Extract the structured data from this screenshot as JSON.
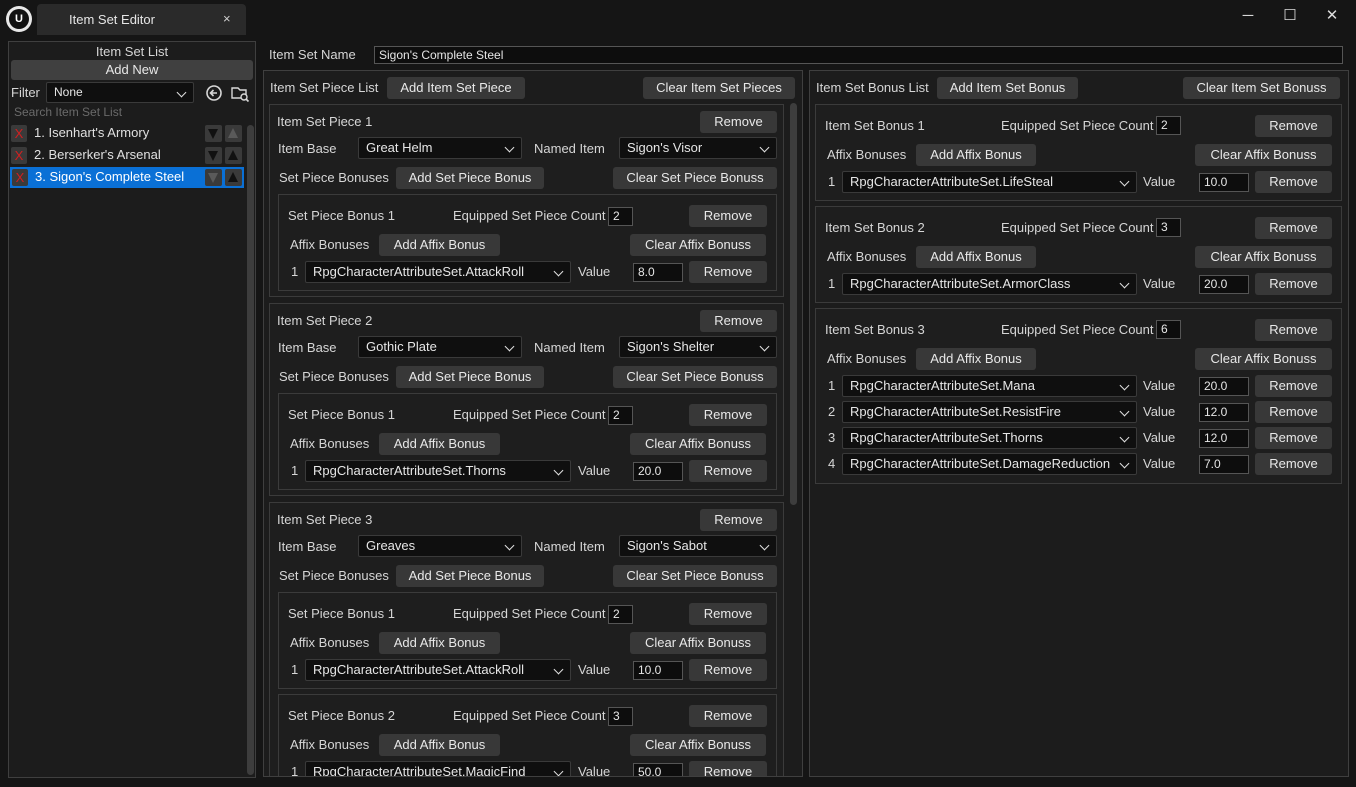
{
  "window": {
    "tab_title": "Item Set Editor",
    "tab_close": "×",
    "minimize": "─",
    "maximize": "☐",
    "close": "✕",
    "logo": "U"
  },
  "sidebar": {
    "title": "Item Set List",
    "add_new": "Add New",
    "filter_label": "Filter",
    "filter_value": "None",
    "search_placeholder": "Search Item Set List",
    "remove_glyph": "X",
    "items": [
      {
        "label": "1.  Isenhart's Armory",
        "selected": false
      },
      {
        "label": "2.  Berserker's Arsenal",
        "selected": false
      },
      {
        "label": "3.  Sigon's Complete Steel",
        "selected": true
      }
    ]
  },
  "header": {
    "name_label": "Item Set Name",
    "name_value": "Sigon's Complete Steel"
  },
  "pieces": {
    "title": "Item Set Piece List",
    "add_label": "Add Item Set Piece",
    "clear_label": "Clear Item Set Pieces",
    "item_base_label": "Item Base",
    "named_item_label": "Named Item",
    "set_piece_bonuses_label": "Set Piece Bonuses",
    "add_set_piece_bonus": "Add Set Piece Bonus",
    "clear_set_piece_bonuss": "Clear Set Piece Bonuss",
    "equipped_count_label": "Equipped Set Piece Count",
    "affix_bonuses_label": "Affix Bonuses",
    "add_affix_bonus": "Add Affix Bonus",
    "clear_affix_bonuss": "Clear Affix Bonuss",
    "value_label": "Value",
    "remove_label": "Remove",
    "list": [
      {
        "title": "Item Set Piece 1",
        "item_base": "Great Helm",
        "named_item": "Sigon's Visor",
        "bonuses": [
          {
            "title": "Set Piece Bonus 1",
            "count": "2",
            "affixes": [
              {
                "idx": "1",
                "attr": "RpgCharacterAttributeSet.AttackRoll",
                "value": "8.0"
              }
            ]
          }
        ]
      },
      {
        "title": "Item Set Piece 2",
        "item_base": "Gothic Plate",
        "named_item": "Sigon's Shelter",
        "bonuses": [
          {
            "title": "Set Piece Bonus 1",
            "count": "2",
            "affixes": [
              {
                "idx": "1",
                "attr": "RpgCharacterAttributeSet.Thorns",
                "value": "20.0"
              }
            ]
          }
        ]
      },
      {
        "title": "Item Set Piece 3",
        "item_base": "Greaves",
        "named_item": "Sigon's Sabot",
        "bonuses": [
          {
            "title": "Set Piece Bonus 1",
            "count": "2",
            "affixes": [
              {
                "idx": "1",
                "attr": "RpgCharacterAttributeSet.AttackRoll",
                "value": "10.0"
              }
            ]
          },
          {
            "title": "Set Piece Bonus 2",
            "count": "3",
            "affixes": [
              {
                "idx": "1",
                "attr": "RpgCharacterAttributeSet.MagicFind",
                "value": "50.0"
              }
            ]
          }
        ]
      }
    ]
  },
  "bonuses": {
    "title": "Item Set Bonus List",
    "add_label": "Add Item Set Bonus",
    "clear_label": "Clear Item Set Bonuss",
    "equipped_count_label": "Equipped Set Piece Count",
    "affix_bonuses_label": "Affix Bonuses",
    "add_affix_bonus": "Add Affix Bonus",
    "clear_affix_bonuss": "Clear Affix Bonuss",
    "value_label": "Value",
    "remove_label": "Remove",
    "list": [
      {
        "title": "Item Set Bonus 1",
        "count": "2",
        "affixes": [
          {
            "idx": "1",
            "attr": "RpgCharacterAttributeSet.LifeSteal",
            "value": "10.0"
          }
        ]
      },
      {
        "title": "Item Set Bonus 2",
        "count": "3",
        "affixes": [
          {
            "idx": "1",
            "attr": "RpgCharacterAttributeSet.ArmorClass",
            "value": "20.0"
          }
        ]
      },
      {
        "title": "Item Set Bonus 3",
        "count": "6",
        "affixes": [
          {
            "idx": "1",
            "attr": "RpgCharacterAttributeSet.Mana",
            "value": "20.0"
          },
          {
            "idx": "2",
            "attr": "RpgCharacterAttributeSet.ResistFire",
            "value": "12.0"
          },
          {
            "idx": "3",
            "attr": "RpgCharacterAttributeSet.Thorns",
            "value": "12.0"
          },
          {
            "idx": "4",
            "attr": "RpgCharacterAttributeSet.DamageReduction",
            "value": "7.0"
          }
        ]
      }
    ]
  },
  "colors": {
    "background": "#151515",
    "panel": "#1c1c1c",
    "button": "#383838",
    "selection": "#0a70d6",
    "remove_x": "#d02020"
  }
}
